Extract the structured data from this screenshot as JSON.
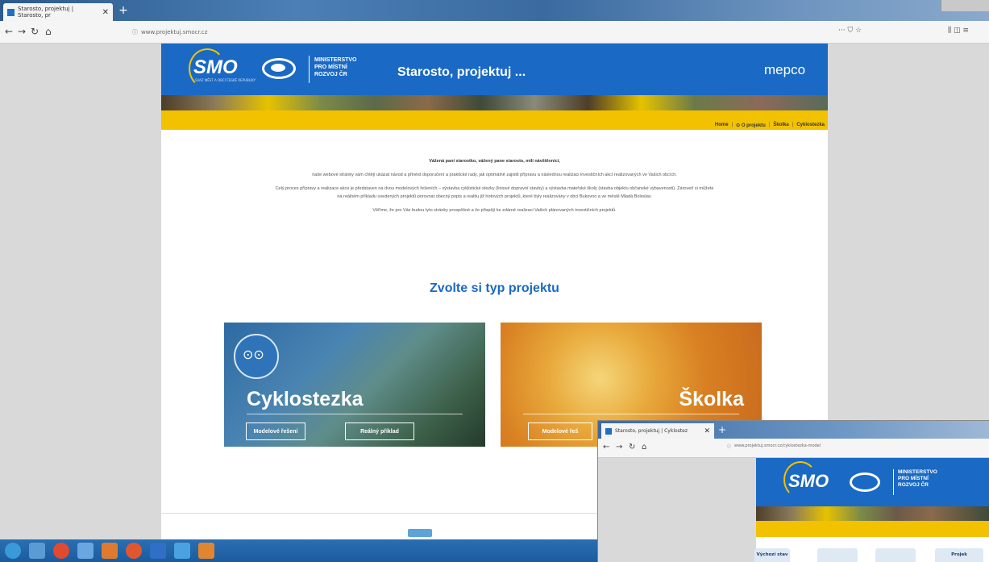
{
  "browser": {
    "tab_title": "Starosto, projektuj | Starosto, pr",
    "tab_close": "✕",
    "new_tab": "+",
    "url": "www.projektuj.smocr.cz",
    "url_icon": "info-icon",
    "right_icons": "··· ⛉ ☆",
    "right_icons_2": "⫼ ◫ ≡"
  },
  "header": {
    "smo": "SMO",
    "smo_sub": "SVAZ MĚST A OBCÍ ČESKÉ REPUBLIKY",
    "ministry_line1": "MINISTERSTVO",
    "ministry_line2": "PRO MÍSTNÍ",
    "ministry_line3": "ROZVOJ ČR",
    "site_title": "Starosto, projektuj ...",
    "mepco": "mepco"
  },
  "menu": {
    "home": "Home",
    "about": "O projektu",
    "skolka": "Školka",
    "cyklostezka": "Cyklostezka",
    "separator": "|"
  },
  "intro": {
    "greeting": "Vážená paní starostko, vážený pane starosto, milí návštěvníci,",
    "p1": "naše webové stránky vám chtějí ukázat návod a přinést doporučení a praktické rady, jak optimálně zajistit přípravu a následnou realizaci investičních akcí realizovaných ve Vašich obcích.",
    "p2": "Celý proces přípravy a realizace akce je představen na dvou modelových řešeních – výstavba cyklistické stezky (liniové dopravní stavby) a výstavba mateřské školy (stavba objektu občanské vybavenosti). Zároveň si můžete na reálném příkladu uvedených projektů porovnat obecný popis a realitu již hotových projektů, které byly realizovány v obci Bukovno a ve městě Mladá Boleslav.",
    "p3": "Věříme, že pro Vás budou tyto stránky prospěšné a že přispějí ke zdárné realizaci Vašich plánovaných investičních projektů."
  },
  "choose_title": "Zvolte si typ projektu",
  "cards": {
    "cyklo_title": "Cyklostezka",
    "cyklo_model": "Modelové řešení",
    "cyklo_real": "Reálný příklad",
    "skolka_title": "Školka",
    "skolka_model": "Modelové řeš"
  },
  "overlay": {
    "tab_title": "Starosto, projektuj | Cyklostez",
    "tab_close": "✕",
    "new_tab": "+",
    "url": "www.projektuj.smocr.cz/cyklostezka-model",
    "smo": "SMO",
    "ministry_line1": "MINISTERSTVO",
    "ministry_line2": "PRO MÍSTNÍ",
    "ministry_line3": "ROZVOJ ČR",
    "btn1": "Výchozí stav",
    "btn4": "Projek"
  },
  "colors": {
    "brand_blue": "#1a69c4",
    "accent_yellow": "#f2c200"
  }
}
